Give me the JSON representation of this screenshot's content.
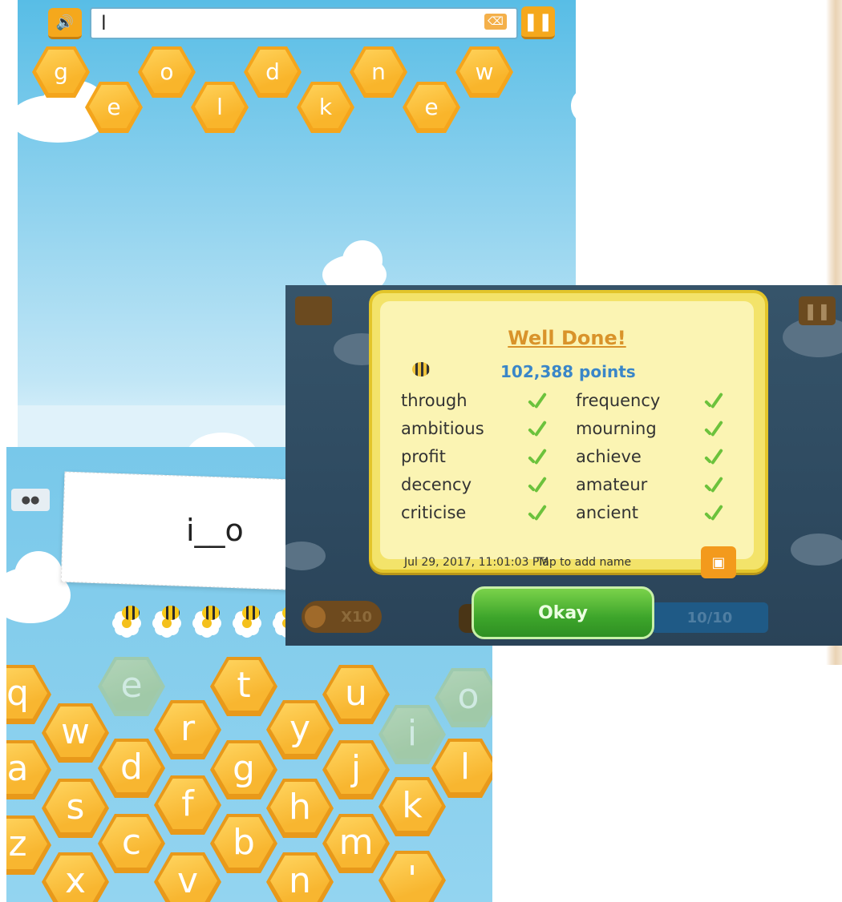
{
  "shot1": {
    "speaker_icon": "speaker-person-icon",
    "input_value": "l",
    "delete_icon": "backspace-icon",
    "pause_icon": "pause-icon",
    "letter_tiles": [
      "g",
      "e",
      "o",
      "l",
      "d",
      "k",
      "n",
      "e",
      "w"
    ]
  },
  "shot2": {
    "title": "Well Done!",
    "points": "102,388 points",
    "words_left": [
      "through",
      "ambitious",
      "profit",
      "decency",
      "criticise"
    ],
    "words_right": [
      "frequency",
      "mourning",
      "achieve",
      "amateur",
      "ancient"
    ],
    "date": "Jul 29, 2017, 11:01:03 PM",
    "tap_to_add_name": "Tap to add name",
    "camera_icon": "camera-icon",
    "multiplier": "X10",
    "okay_label": "Okay",
    "progress": "10/10"
  },
  "shot3": {
    "word_pattern": "i__o",
    "keys": [
      {
        "letter": "q"
      },
      {
        "letter": "e"
      },
      {
        "letter": "t"
      },
      {
        "letter": "u"
      },
      {
        "letter": "o"
      },
      {
        "letter": "w"
      },
      {
        "letter": "r"
      },
      {
        "letter": "y"
      },
      {
        "letter": "i"
      },
      {
        "letter": "a"
      },
      {
        "letter": "d"
      },
      {
        "letter": "g"
      },
      {
        "letter": "j"
      },
      {
        "letter": "l"
      },
      {
        "letter": "s"
      },
      {
        "letter": "f"
      },
      {
        "letter": "h"
      },
      {
        "letter": "k"
      },
      {
        "letter": "z"
      },
      {
        "letter": "c"
      },
      {
        "letter": "b"
      },
      {
        "letter": "m"
      },
      {
        "letter": "x"
      },
      {
        "letter": "v"
      },
      {
        "letter": "n"
      },
      {
        "letter": "'"
      }
    ]
  }
}
